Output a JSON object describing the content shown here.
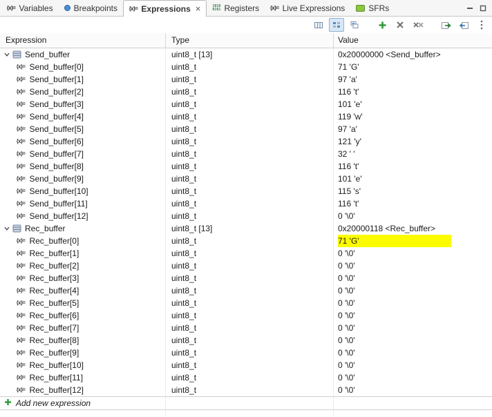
{
  "view": {
    "tabs": [
      {
        "label": "Variables",
        "icon": "variables-icon",
        "active": false,
        "closable": false
      },
      {
        "label": "Breakpoints",
        "icon": "breakpoint-icon",
        "active": false,
        "closable": false
      },
      {
        "label": "Expressions",
        "icon": "expressions-icon",
        "active": true,
        "closable": true
      },
      {
        "label": "Registers",
        "icon": "registers-icon",
        "active": false,
        "closable": false
      },
      {
        "label": "Live Expressions",
        "icon": "live-expressions-icon",
        "active": false,
        "closable": false
      },
      {
        "label": "SFRs",
        "icon": "sfrs-icon",
        "active": false,
        "closable": false
      }
    ],
    "window_controls": [
      "minimize",
      "maximize"
    ]
  },
  "toolbar": {
    "icons": [
      "show-columns",
      "show-logical-structure",
      "collapse-all",
      "add-expression",
      "remove-expression",
      "remove-all-expressions",
      "export-expressions",
      "import-expressions",
      "view-menu"
    ],
    "pressed": "show-logical-structure"
  },
  "table": {
    "columns": [
      "Expression",
      "Type",
      "Value"
    ],
    "add_row_label": "Add new expression",
    "rows": [
      {
        "name": "Send_buffer",
        "type": "uint8_t [13]",
        "value": "0x20000000 <Send_buffer>",
        "level": 0,
        "expanded": true
      },
      {
        "name": "Send_buffer[0]",
        "type": "uint8_t",
        "value": "71 'G'",
        "level": 1
      },
      {
        "name": "Send_buffer[1]",
        "type": "uint8_t",
        "value": "97 'a'",
        "level": 1
      },
      {
        "name": "Send_buffer[2]",
        "type": "uint8_t",
        "value": "116 't'",
        "level": 1
      },
      {
        "name": "Send_buffer[3]",
        "type": "uint8_t",
        "value": "101 'e'",
        "level": 1
      },
      {
        "name": "Send_buffer[4]",
        "type": "uint8_t",
        "value": "119 'w'",
        "level": 1
      },
      {
        "name": "Send_buffer[5]",
        "type": "uint8_t",
        "value": "97 'a'",
        "level": 1
      },
      {
        "name": "Send_buffer[6]",
        "type": "uint8_t",
        "value": "121 'y'",
        "level": 1
      },
      {
        "name": "Send_buffer[7]",
        "type": "uint8_t",
        "value": "32 ' '",
        "level": 1
      },
      {
        "name": "Send_buffer[8]",
        "type": "uint8_t",
        "value": "116 't'",
        "level": 1
      },
      {
        "name": "Send_buffer[9]",
        "type": "uint8_t",
        "value": "101 'e'",
        "level": 1
      },
      {
        "name": "Send_buffer[10]",
        "type": "uint8_t",
        "value": "115 's'",
        "level": 1
      },
      {
        "name": "Send_buffer[11]",
        "type": "uint8_t",
        "value": "116 't'",
        "level": 1
      },
      {
        "name": "Send_buffer[12]",
        "type": "uint8_t",
        "value": "0 '\\0'",
        "level": 1
      },
      {
        "name": "Rec_buffer",
        "type": "uint8_t [13]",
        "value": "0x20000118 <Rec_buffer>",
        "level": 0,
        "expanded": true
      },
      {
        "name": "Rec_buffer[0]",
        "type": "uint8_t",
        "value": "71 'G'",
        "level": 1,
        "highlight": true
      },
      {
        "name": "Rec_buffer[1]",
        "type": "uint8_t",
        "value": "0 '\\0'",
        "level": 1
      },
      {
        "name": "Rec_buffer[2]",
        "type": "uint8_t",
        "value": "0 '\\0'",
        "level": 1
      },
      {
        "name": "Rec_buffer[3]",
        "type": "uint8_t",
        "value": "0 '\\0'",
        "level": 1
      },
      {
        "name": "Rec_buffer[4]",
        "type": "uint8_t",
        "value": "0 '\\0'",
        "level": 1
      },
      {
        "name": "Rec_buffer[5]",
        "type": "uint8_t",
        "value": "0 '\\0'",
        "level": 1
      },
      {
        "name": "Rec_buffer[6]",
        "type": "uint8_t",
        "value": "0 '\\0'",
        "level": 1
      },
      {
        "name": "Rec_buffer[7]",
        "type": "uint8_t",
        "value": "0 '\\0'",
        "level": 1
      },
      {
        "name": "Rec_buffer[8]",
        "type": "uint8_t",
        "value": "0 '\\0'",
        "level": 1
      },
      {
        "name": "Rec_buffer[9]",
        "type": "uint8_t",
        "value": "0 '\\0'",
        "level": 1
      },
      {
        "name": "Rec_buffer[10]",
        "type": "uint8_t",
        "value": "0 '\\0'",
        "level": 1
      },
      {
        "name": "Rec_buffer[11]",
        "type": "uint8_t",
        "value": "0 '\\0'",
        "level": 1
      },
      {
        "name": "Rec_buffer[12]",
        "type": "uint8_t",
        "value": "0 '\\0'",
        "level": 1
      }
    ]
  },
  "colors": {
    "highlight": "#fcfc00",
    "accent_green": "#2f9b36",
    "tab_bg": "#f6f6f6"
  }
}
